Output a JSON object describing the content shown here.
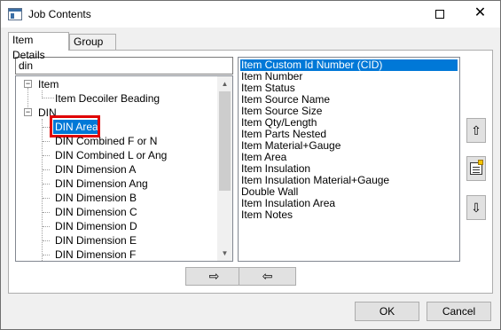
{
  "window": {
    "title": "Job Contents",
    "close_glyph": "✕",
    "app_icon": "window-app-icon"
  },
  "tabs": [
    {
      "label": "Item Details",
      "active": true
    },
    {
      "label": "Group By",
      "active": false
    }
  ],
  "search": {
    "value": "din"
  },
  "tree": {
    "expander_open": "−",
    "nodes": [
      {
        "label": "Item"
      },
      {
        "label": "Item Decoiler Beading"
      },
      {
        "label": "DIN"
      },
      {
        "label": "DIN Area",
        "selected": true
      },
      {
        "label": "DIN Combined F or N"
      },
      {
        "label": "DIN Combined L or Ang"
      },
      {
        "label": "DIN Dimension A"
      },
      {
        "label": "DIN Dimension Ang"
      },
      {
        "label": "DIN Dimension B"
      },
      {
        "label": "DIN Dimension C"
      },
      {
        "label": "DIN Dimension D"
      },
      {
        "label": "DIN Dimension E"
      },
      {
        "label": "DIN Dimension F"
      }
    ],
    "scroll_up": "▲",
    "scroll_down": "▼"
  },
  "list": {
    "items": [
      {
        "label": "Item Custom Id Number (CID)",
        "selected": true
      },
      {
        "label": "Item Number"
      },
      {
        "label": "Item Status"
      },
      {
        "label": "Item Source Name"
      },
      {
        "label": "Item Source Size"
      },
      {
        "label": "Item Qty/Length"
      },
      {
        "label": "Item Parts Nested"
      },
      {
        "label": "Item Material+Gauge"
      },
      {
        "label": "Item Area"
      },
      {
        "label": "Item Insulation"
      },
      {
        "label": "Item Insulation Material+Gauge"
      },
      {
        "label": "Double Wall"
      },
      {
        "label": "Item Insulation Area"
      },
      {
        "label": "Item Notes"
      }
    ]
  },
  "side_buttons": {
    "move_up_glyph": "⇧",
    "move_down_glyph": "⇩",
    "properties_icon": "properties-icon"
  },
  "move_buttons": {
    "add_glyph": "⇨",
    "remove_glyph": "⇦"
  },
  "dialog_buttons": {
    "ok": "OK",
    "cancel": "Cancel"
  },
  "colors": {
    "selection": "#0078d7",
    "highlight_box": "#e00000"
  }
}
